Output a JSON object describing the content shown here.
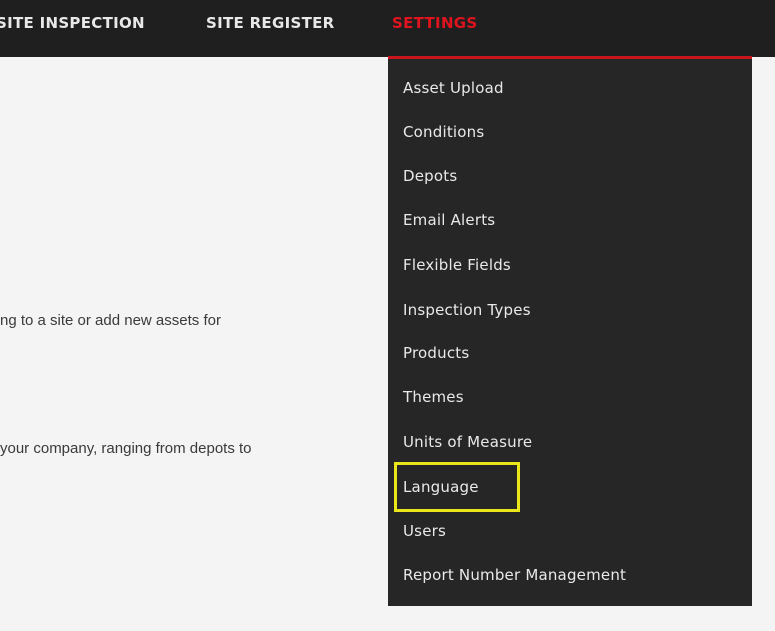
{
  "topnav": {
    "items": [
      "SITE INSPECTION",
      "SITE REGISTER",
      "SETTINGS"
    ],
    "active_color": "#e0141f",
    "background": "#1f1f1f"
  },
  "body": {
    "text_1": "ng to a site or add new assets for",
    "text_2": "your company, ranging from depots to"
  },
  "settings_menu": {
    "items": [
      "Asset Upload",
      "Conditions",
      "Depots",
      "Email Alerts",
      "Flexible Fields",
      "Inspection Types",
      "Products",
      "Themes",
      "Units of Measure",
      "Language",
      "Users",
      "Report Number Management"
    ],
    "highlighted_item": "Language",
    "highlight_color": "#e9e61a"
  }
}
